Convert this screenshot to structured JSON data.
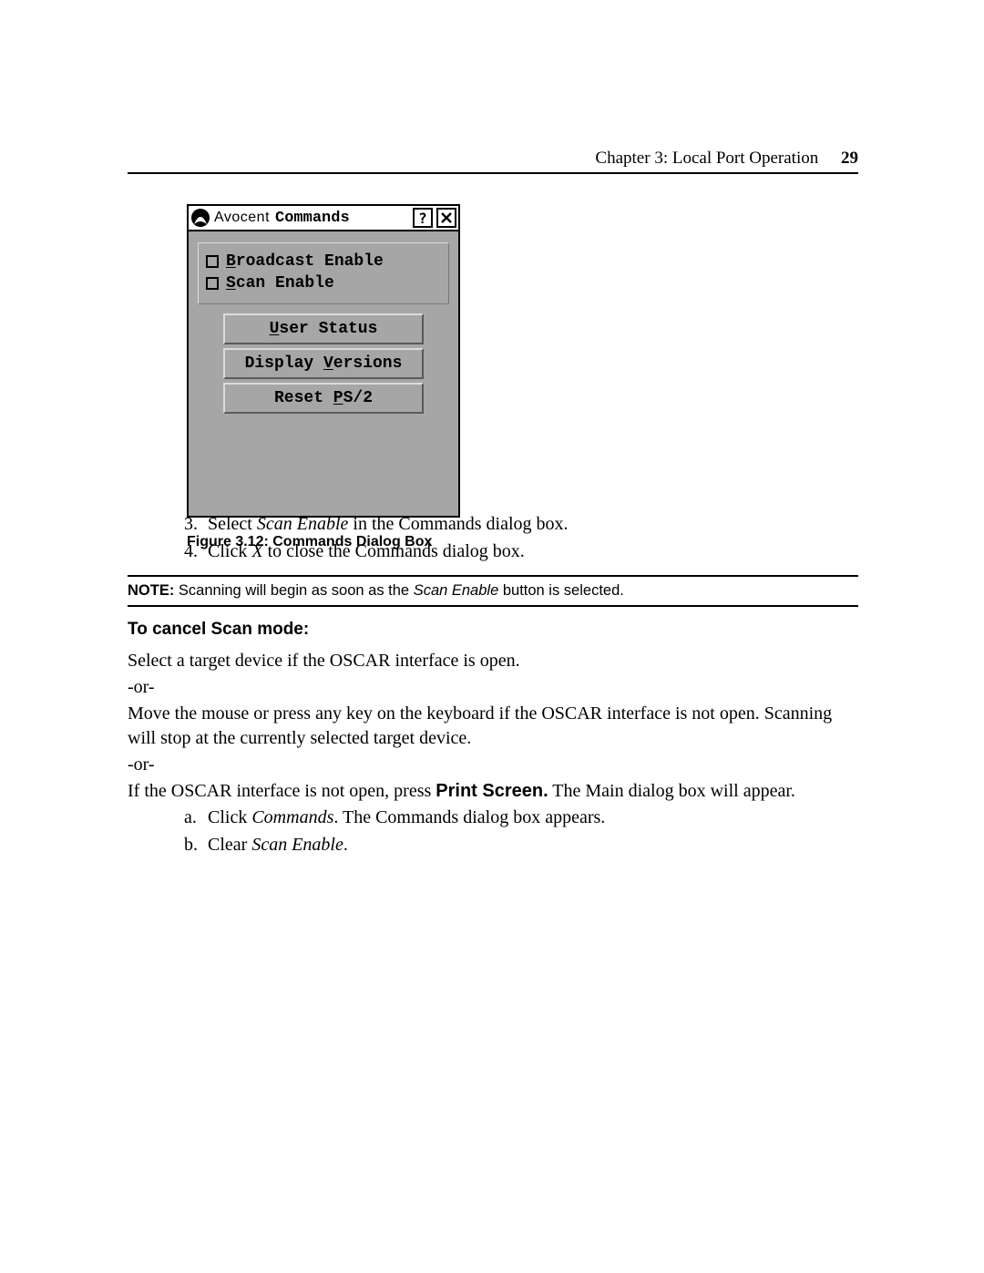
{
  "header": {
    "chapter_line": "Chapter 3: Local Port Operation",
    "page_number": "29"
  },
  "dialog": {
    "brand": "Avocent",
    "title": "Commands",
    "help_label": "?",
    "close_label": "X",
    "checkbox_broadcast": "Broadcast Enable",
    "checkbox_scan": "Scan Enable",
    "buttons": {
      "user_status": "User Status",
      "display_versions": "Display Versions",
      "reset_ps2": "Reset PS/2"
    }
  },
  "figure_caption": "Figure 3.12: Commands Dialog Box",
  "steps": {
    "s3_num": "3.",
    "s3_a": "Select ",
    "s3_i": "Scan Enable",
    "s3_b": " in the Commands dialog box.",
    "s4_num": "4.",
    "s4_a": "Click ",
    "s4_i": "X",
    "s4_b": " to close the Commands dialog box."
  },
  "note": {
    "bold": "NOTE:",
    "before": " Scanning will begin as soon as the ",
    "ital": "Scan Enable",
    "after": " button is selected."
  },
  "section_heading": "To cancel Scan mode:",
  "cancel": {
    "p1": "Select a target device if the OSCAR interface is open.",
    "or": "-or-",
    "p2": "Move the mouse or press any key on the keyboard if the OSCAR interface is not open. Scanning will stop at the currently selected target device.",
    "p3_a": "If the OSCAR interface is not open, press ",
    "p3_bold": "Print Screen.",
    "p3_b": " The Main dialog box will appear.",
    "sa_num": "a.",
    "sa_a": "Click ",
    "sa_i": "Commands",
    "sa_b": ". The Commands dialog box appears.",
    "sb_num": "b.",
    "sb_a": "Clear ",
    "sb_i": "Scan Enable",
    "sb_b": "."
  }
}
